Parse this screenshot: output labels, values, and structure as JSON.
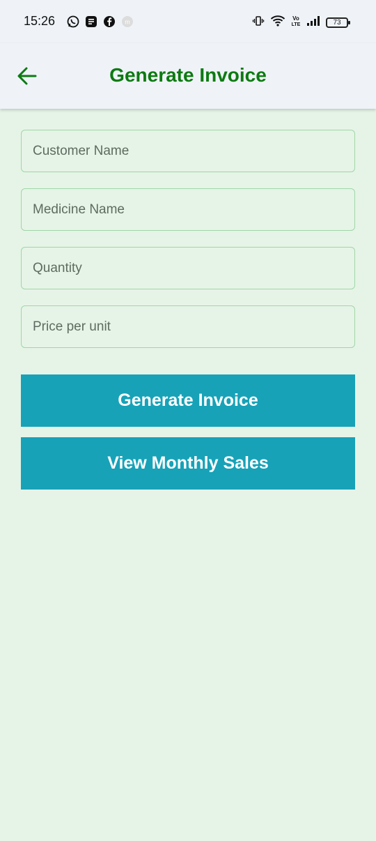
{
  "status_bar": {
    "time": "15:26",
    "battery_level": "73",
    "notification_icons": [
      "whatsapp-icon",
      "notes-icon",
      "facebook-icon",
      "app-icon"
    ],
    "system_icons": [
      "vibrate-icon",
      "wifi-icon",
      "volte-icon",
      "signal-icon",
      "battery-icon"
    ]
  },
  "app_bar": {
    "title": "Generate Invoice",
    "back_icon": "arrow-left-icon"
  },
  "form": {
    "customer_name": {
      "placeholder": "Customer Name",
      "value": ""
    },
    "medicine_name": {
      "placeholder": "Medicine Name",
      "value": ""
    },
    "quantity": {
      "placeholder": "Quantity",
      "value": ""
    },
    "price_per_unit": {
      "placeholder": "Price per unit",
      "value": ""
    }
  },
  "actions": {
    "generate_invoice": "Generate Invoice",
    "view_monthly_sales": "View Monthly Sales"
  },
  "colors": {
    "background": "#e6f4e7",
    "app_bar": "#eff3f8",
    "title": "#0d7a12",
    "button": "#17a2b8",
    "field_border": "#9fd6a6"
  }
}
